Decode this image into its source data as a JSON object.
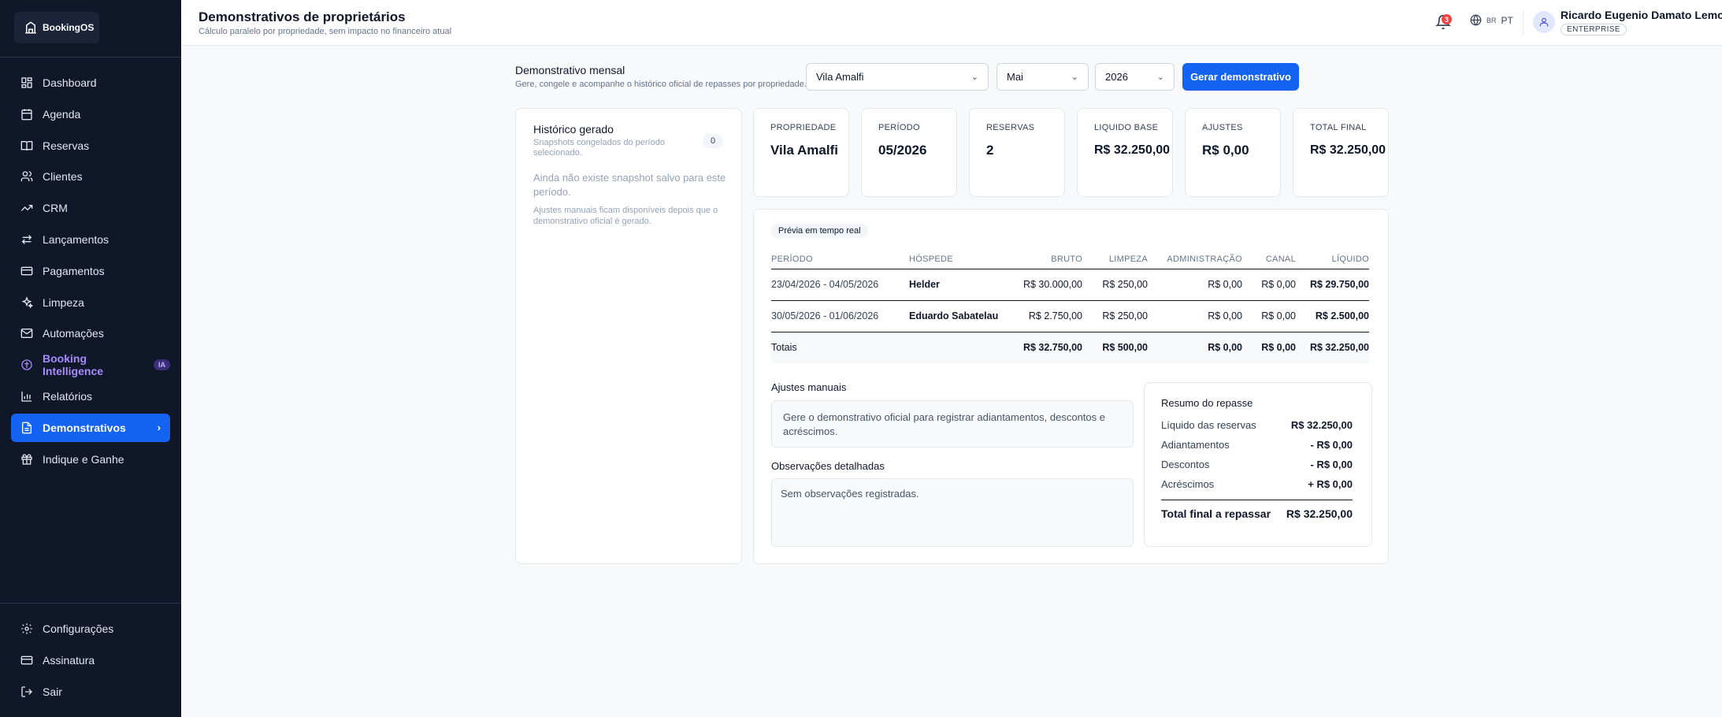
{
  "app": {
    "logo_text": "BookingOS"
  },
  "sidebar": {
    "items": [
      {
        "label": "Dashboard",
        "icon": "grid-icon"
      },
      {
        "label": "Agenda",
        "icon": "calendar-icon"
      },
      {
        "label": "Reservas",
        "icon": "book-icon"
      },
      {
        "label": "Clientes",
        "icon": "users-icon"
      },
      {
        "label": "CRM",
        "icon": "trending-up-icon"
      },
      {
        "label": "Lançamentos",
        "icon": "arrows-icon"
      },
      {
        "label": "Pagamentos",
        "icon": "credit-card-icon"
      },
      {
        "label": "Limpeza",
        "icon": "sparkles-icon"
      },
      {
        "label": "Automações",
        "icon": "mail-icon"
      },
      {
        "label": "Booking Intelligence",
        "icon": "intelligence-icon",
        "badge": "IA"
      },
      {
        "label": "Relatórios",
        "icon": "bar-chart-icon"
      },
      {
        "label": "Demonstrativos",
        "icon": "file-text-icon",
        "active": true
      },
      {
        "label": "Indique e Ganhe",
        "icon": "gift-icon"
      }
    ],
    "bottom_items": [
      {
        "label": "Configurações",
        "icon": "gear-icon"
      },
      {
        "label": "Assinatura",
        "icon": "credit-card-icon"
      },
      {
        "label": "Sair",
        "icon": "logout-icon"
      }
    ]
  },
  "header": {
    "title": "Demonstrativos de proprietários",
    "subtitle": "Cálculo paralelo por propriedade, sem impacto no financeiro atual",
    "notifications": "3",
    "lang_flag": "BR",
    "lang": "PT",
    "user_name": "Ricardo Eugenio Damato Lemos",
    "plan": "ENTERPRISE"
  },
  "controls": {
    "title": "Demonstrativo mensal",
    "subtitle": "Gere, congele e acompanhe o histórico oficial de repasses por propriedade.",
    "property": "Vila Amalfi",
    "month": "Mai",
    "year": "2026",
    "generate_label": "Gerar demonstrativo"
  },
  "history": {
    "title": "Histórico gerado",
    "subtitle": "Snapshots congelados do período selecionado.",
    "count": "0",
    "empty": "Ainda não existe snapshot salvo para este período.",
    "note": "Ajustes manuais ficam disponíveis depois que o demonstrativo oficial é gerado."
  },
  "stats": [
    {
      "label": "PROPRIEDADE",
      "value": "Vila Amalfi"
    },
    {
      "label": "PERÍODO",
      "value": "05/2026"
    },
    {
      "label": "RESERVAS",
      "value": "2"
    },
    {
      "label": "LIQUIDO BASE",
      "value": "R$ 32.250,00"
    },
    {
      "label": "AJUSTES",
      "value": "R$ 0,00"
    },
    {
      "label": "TOTAL FINAL",
      "value": "R$ 32.250,00"
    }
  ],
  "preview": {
    "pill": "Prévia em tempo real",
    "headers": [
      "PERÍODO",
      "HÓSPEDE",
      "BRUTO",
      "LIMPEZA",
      "ADMINISTRAÇÃO",
      "CANAL",
      "LÍQUIDO"
    ],
    "rows": [
      [
        "23/04/2026 - 04/05/2026",
        "Helder",
        "R$ 30.000,00",
        "R$ 250,00",
        "R$ 0,00",
        "R$ 0,00",
        "R$ 29.750,00"
      ],
      [
        "30/05/2026 - 01/06/2026",
        "Eduardo Sabatelau",
        "R$ 2.750,00",
        "R$ 250,00",
        "R$ 0,00",
        "R$ 0,00",
        "R$ 2.500,00"
      ]
    ],
    "totals": [
      "Totais",
      "",
      "R$ 32.750,00",
      "R$ 500,00",
      "R$ 0,00",
      "R$ 0,00",
      "R$ 32.250,00"
    ]
  },
  "adjustments": {
    "title": "Ajustes manuais",
    "text": "Gere o demonstrativo oficial para registrar adiantamentos, descontos e acréscimos."
  },
  "observations": {
    "title": "Observações detalhadas",
    "text": "Sem observações registradas."
  },
  "summary": {
    "title": "Resumo do repasse",
    "rows": [
      {
        "label": "Líquido das reservas",
        "value": "R$ 32.250,00"
      },
      {
        "label": "Adiantamentos",
        "value": "- R$ 0,00"
      },
      {
        "label": "Descontos",
        "value": "- R$ 0,00"
      },
      {
        "label": "Acréscimos",
        "value": "+ R$ 0,00"
      }
    ],
    "total_label": "Total final a repassar",
    "total_value": "R$ 32.250,00"
  }
}
